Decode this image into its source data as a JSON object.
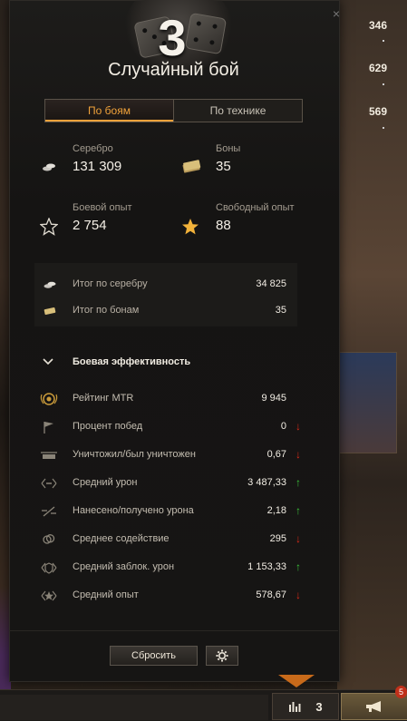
{
  "background": {
    "right_values": [
      "346",
      "629",
      "569"
    ]
  },
  "panel": {
    "close_label": "×",
    "battle_count": "3",
    "title": "Случайный бой",
    "tabs": [
      {
        "label": "По боям",
        "active": true
      },
      {
        "label": "По технике",
        "active": false
      }
    ],
    "stats": {
      "silver": {
        "label": "Серебро",
        "value": "131 309",
        "icon": "silver-coins-icon"
      },
      "bonds": {
        "label": "Боны",
        "value": "35",
        "icon": "bonds-icon"
      },
      "combat_xp": {
        "label": "Боевой опыт",
        "value": "2 754",
        "icon": "star-outline-icon"
      },
      "free_xp": {
        "label": "Свободный опыт",
        "value": "88",
        "icon": "star-filled-icon"
      }
    },
    "totals": [
      {
        "label": "Итог по серебру",
        "value": "34 825",
        "icon": "silver-coins-icon"
      },
      {
        "label": "Итог по бонам",
        "value": "35",
        "icon": "bonds-icon"
      }
    ],
    "efficiency": {
      "heading": "Боевая эффективность",
      "rows": [
        {
          "label": "Рейтинг MTR",
          "value": "9 945",
          "icon": "rating-badge-icon",
          "trend": ""
        },
        {
          "label": "Процент побед",
          "value": "0",
          "icon": "flag-icon",
          "trend": "down"
        },
        {
          "label": "Уничтожил/был уничтожен",
          "value": "0,67",
          "icon": "destroyed-icon",
          "trend": "down"
        },
        {
          "label": "Средний урон",
          "value": "3 487,33",
          "icon": "damage-icon",
          "trend": "up"
        },
        {
          "label": "Нанесено/получено урона",
          "value": "2,18",
          "icon": "damage-ratio-icon",
          "trend": "up"
        },
        {
          "label": "Среднее содействие",
          "value": "295",
          "icon": "assist-icon",
          "trend": "down"
        },
        {
          "label": "Средний заблок. урон",
          "value": "1 153,33",
          "icon": "blocked-damage-icon",
          "trend": "up"
        },
        {
          "label": "Средний опыт",
          "value": "578,67",
          "icon": "xp-icon",
          "trend": "down"
        }
      ]
    },
    "reset_label": "Сбросить"
  },
  "bottom_bar": {
    "stats_count": "3",
    "notification_count": "5"
  },
  "colors": {
    "accent": "#f0a23a",
    "up": "#3ac13a",
    "down": "#d82a1a"
  }
}
